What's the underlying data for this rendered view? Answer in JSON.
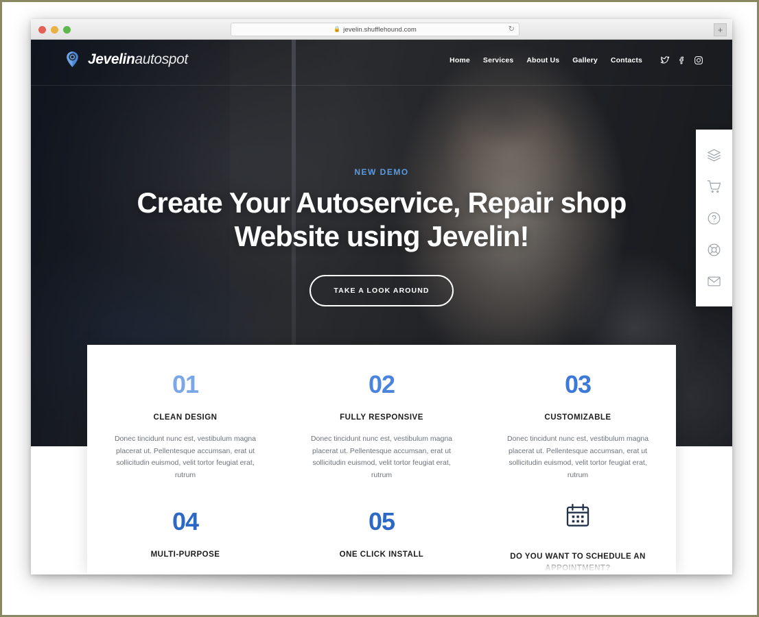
{
  "browser": {
    "url": "jevelin.shufflehound.com",
    "lock_icon": "lock-icon",
    "reload_icon": "reload-icon",
    "new_tab_label": "+"
  },
  "site": {
    "logo": {
      "bold": "Jevelin",
      "light": "autospot",
      "icon": "map-pin-icon"
    },
    "nav": [
      {
        "label": "Home"
      },
      {
        "label": "Services"
      },
      {
        "label": "About Us"
      },
      {
        "label": "Gallery"
      },
      {
        "label": "Contacts"
      }
    ],
    "socials": [
      {
        "name": "twitter-icon"
      },
      {
        "name": "facebook-icon"
      },
      {
        "name": "instagram-icon"
      }
    ]
  },
  "hero": {
    "eyebrow": "NEW DEMO",
    "title": "Create Your Autoservice, Repair shop Website using Jevelin!",
    "cta_label": "TAKE A LOOK AROUND",
    "accent_color": "#5b9be0"
  },
  "dock": [
    {
      "name": "layers-icon"
    },
    {
      "name": "shopping-cart-icon"
    },
    {
      "name": "help-question-icon"
    },
    {
      "name": "life-ring-icon"
    },
    {
      "name": "envelope-icon"
    }
  ],
  "features": {
    "body_text": "Donec tincidunt nunc est, vestibulum magna placerat ut. Pellentesque accumsan, erat ut sollicitudin euismod, velit tortor feugiat erat, rutrum",
    "row1": [
      {
        "number": "01",
        "title": "CLEAN DESIGN",
        "color": "#7ba7e8"
      },
      {
        "number": "02",
        "title": "FULLY RESPONSIVE",
        "color": "#4a84dd"
      },
      {
        "number": "03",
        "title": "CUSTOMIZABLE",
        "color": "#3c79d8"
      }
    ],
    "row2": [
      {
        "number": "04",
        "title": "MULTI-PURPOSE",
        "color": "#2e68c5"
      },
      {
        "number": "05",
        "title": "ONE CLICK INSTALL",
        "color": "#2e68c5"
      }
    ],
    "schedule": {
      "icon": "calendar-icon",
      "title": "DO YOU WANT TO SCHEDULE AN APPOINTMENT?"
    }
  }
}
